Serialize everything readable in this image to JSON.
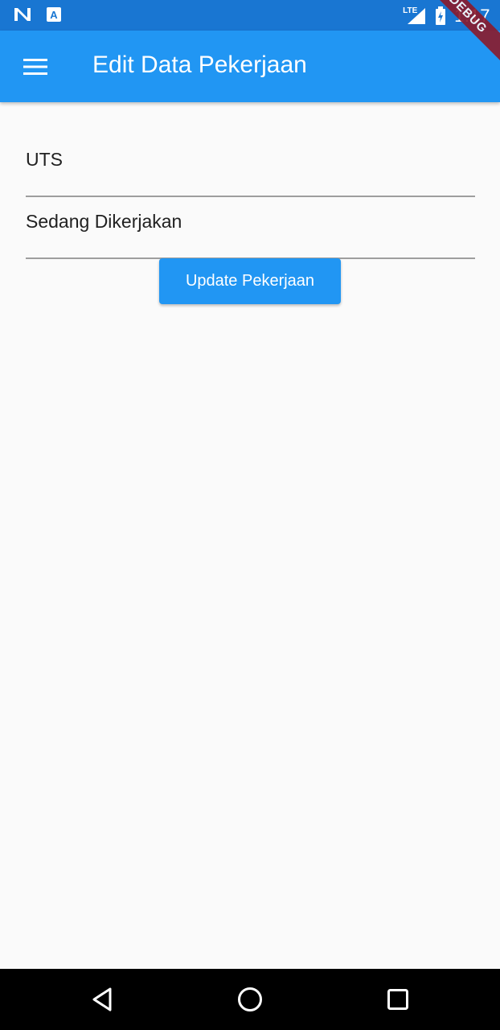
{
  "status_bar": {
    "network": "LTE",
    "time": "1:17"
  },
  "app_bar": {
    "title": "Edit Data Pekerjaan",
    "menu_icon": "hamburger-menu-icon"
  },
  "debug_banner": {
    "label": "DEBUG"
  },
  "form": {
    "fields": [
      {
        "value": "UTS"
      },
      {
        "value": "Sedang Dikerjakan"
      }
    ],
    "submit_label": "Update Pekerjaan"
  },
  "nav_bar": {
    "back_icon": "back-triangle-icon",
    "home_icon": "home-circle-icon",
    "recents_icon": "recents-square-icon"
  },
  "colors": {
    "primary": "#2196f3",
    "status_bar": "#1976d2",
    "debug_ribbon": "#8b1a2b"
  }
}
